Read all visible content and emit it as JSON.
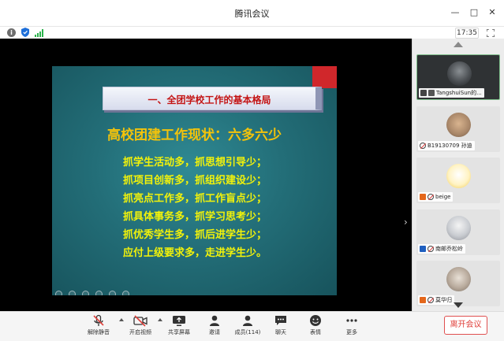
{
  "window": {
    "title": "腾讯会议"
  },
  "infobar": {
    "clock": "17:35"
  },
  "slide": {
    "banner": "一、全团学校工作的基本格局",
    "heading": "高校团建工作现状：六多六少",
    "lines": [
      "抓学生活动多，抓思想引导少；",
      "抓项目创新多，抓组织建设少；",
      "抓亮点工作多，抓工作盲点少；",
      "抓具体事务多，抓学习思考少；",
      "抓优秀学生多，抓后进学生少；",
      "应付上级要求多，走进学生少。"
    ]
  },
  "participants": [
    {
      "name": "TangshuiSun的...",
      "status_icon": "screen-share-icon",
      "active": true
    },
    {
      "name": "B19130709 孙迪",
      "status_icon": "mic-off-icon",
      "active": false
    },
    {
      "name": "beige",
      "status_icon": "mic-off-icon",
      "active": false
    },
    {
      "name": "南邮乔松岭",
      "status_icon": "mic-off-icon",
      "active": false
    },
    {
      "name": "莫华归",
      "status_icon": "mic-off-icon",
      "active": false
    }
  ],
  "toolbar": {
    "unmute": "解除静音",
    "video": "开启视频",
    "share": "共享屏幕",
    "invite": "邀请",
    "members": "成员(114)",
    "chat": "聊天",
    "emoji": "表情",
    "more": "更多",
    "leave": "离开会议"
  }
}
